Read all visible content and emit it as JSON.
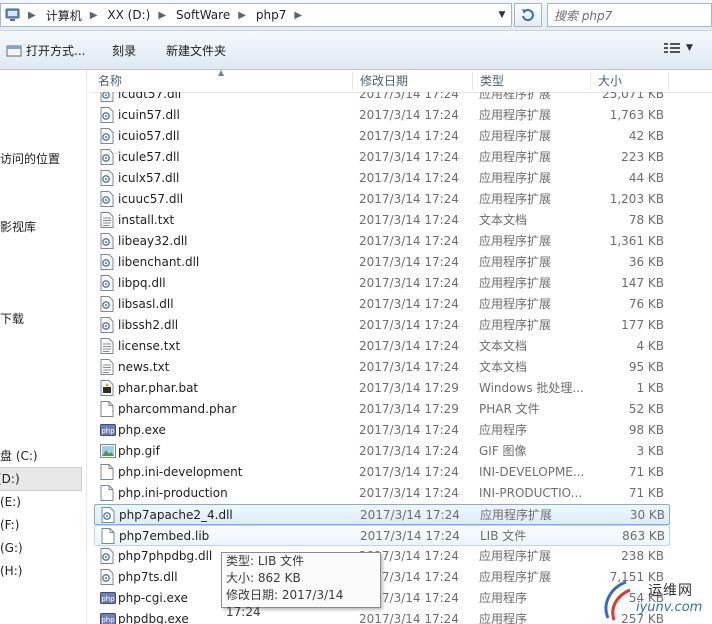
{
  "address": {
    "crumbs": [
      "计算机",
      "XX (D:)",
      "SoftWare",
      "php7"
    ]
  },
  "search": {
    "placeholder": "搜索 php7"
  },
  "toolbar": {
    "open_with": "打开方式...",
    "burn": "刻录",
    "new_folder": "新建文件夹"
  },
  "nav": {
    "items": [
      "访问的位置",
      "影视库",
      "下载",
      "盘 (C:)",
      "(D:)",
      "(E:)",
      "(F:)",
      "(G:)",
      "(H:)"
    ]
  },
  "columns": {
    "name": "名称",
    "date": "修改日期",
    "type": "类型",
    "size": "大小"
  },
  "files": [
    {
      "name": "icudt57.dll",
      "date": "2017/3/14 17:24",
      "type": "应用程序扩展",
      "size": "25,071 KB",
      "icon": "dll-icon"
    },
    {
      "name": "icuin57.dll",
      "date": "2017/3/14 17:24",
      "type": "应用程序扩展",
      "size": "1,763 KB",
      "icon": "dll-icon"
    },
    {
      "name": "icuio57.dll",
      "date": "2017/3/14 17:24",
      "type": "应用程序扩展",
      "size": "42 KB",
      "icon": "dll-icon"
    },
    {
      "name": "icule57.dll",
      "date": "2017/3/14 17:24",
      "type": "应用程序扩展",
      "size": "223 KB",
      "icon": "dll-icon"
    },
    {
      "name": "iculx57.dll",
      "date": "2017/3/14 17:24",
      "type": "应用程序扩展",
      "size": "44 KB",
      "icon": "dll-icon"
    },
    {
      "name": "icuuc57.dll",
      "date": "2017/3/14 17:24",
      "type": "应用程序扩展",
      "size": "1,203 KB",
      "icon": "dll-icon"
    },
    {
      "name": "install.txt",
      "date": "2017/3/14 17:24",
      "type": "文本文档",
      "size": "78 KB",
      "icon": "text-file-icon"
    },
    {
      "name": "libeay32.dll",
      "date": "2017/3/14 17:24",
      "type": "应用程序扩展",
      "size": "1,361 KB",
      "icon": "dll-icon"
    },
    {
      "name": "libenchant.dll",
      "date": "2017/3/14 17:24",
      "type": "应用程序扩展",
      "size": "36 KB",
      "icon": "dll-icon"
    },
    {
      "name": "libpq.dll",
      "date": "2017/3/14 17:24",
      "type": "应用程序扩展",
      "size": "147 KB",
      "icon": "dll-icon"
    },
    {
      "name": "libsasl.dll",
      "date": "2017/3/14 17:24",
      "type": "应用程序扩展",
      "size": "76 KB",
      "icon": "dll-icon"
    },
    {
      "name": "libssh2.dll",
      "date": "2017/3/14 17:24",
      "type": "应用程序扩展",
      "size": "177 KB",
      "icon": "dll-icon"
    },
    {
      "name": "license.txt",
      "date": "2017/3/14 17:24",
      "type": "文本文档",
      "size": "4 KB",
      "icon": "text-file-icon"
    },
    {
      "name": "news.txt",
      "date": "2017/3/14 17:24",
      "type": "文本文档",
      "size": "95 KB",
      "icon": "text-file-icon"
    },
    {
      "name": "phar.phar.bat",
      "date": "2017/3/14 17:29",
      "type": "Windows 批处理...",
      "size": "1 KB",
      "icon": "batch-file-icon"
    },
    {
      "name": "pharcommand.phar",
      "date": "2017/3/14 17:29",
      "type": "PHAR 文件",
      "size": "52 KB",
      "icon": "blank-file-icon"
    },
    {
      "name": "php.exe",
      "date": "2017/3/14 17:24",
      "type": "应用程序",
      "size": "98 KB",
      "icon": "php-exe-icon"
    },
    {
      "name": "php.gif",
      "date": "2017/3/14 17:24",
      "type": "GIF 图像",
      "size": "3 KB",
      "icon": "image-file-icon"
    },
    {
      "name": "php.ini-development",
      "date": "2017/3/14 17:24",
      "type": "INI-DEVELOPME...",
      "size": "71 KB",
      "icon": "blank-file-icon"
    },
    {
      "name": "php.ini-production",
      "date": "2017/3/14 17:24",
      "type": "INI-PRODUCTIO...",
      "size": "71 KB",
      "icon": "blank-file-icon"
    },
    {
      "name": "php7apache2_4.dll",
      "date": "2017/3/14 17:24",
      "type": "应用程序扩展",
      "size": "30 KB",
      "icon": "dll-icon"
    },
    {
      "name": "php7embed.lib",
      "date": "2017/3/14 17:24",
      "type": "LIB 文件",
      "size": "863 KB",
      "icon": "blank-file-icon"
    },
    {
      "name": "php7phpdbg.dll",
      "date": "2017/3/14 17:24",
      "type": "应用程序扩展",
      "size": "238 KB",
      "icon": "dll-icon"
    },
    {
      "name": "php7ts.dll",
      "date": "2017/3/14 17:24",
      "type": "应用程序扩展",
      "size": "7,151 KB",
      "icon": "dll-icon"
    },
    {
      "name": "php-cgi.exe",
      "date": "2017/3/14 17:24",
      "type": "应用程序",
      "size": "54 KB",
      "icon": "php-exe-icon"
    },
    {
      "name": "phpdbg.exe",
      "date": "2017/3/14 17:24",
      "type": "应用程序",
      "size": "257 KB",
      "icon": "php-exe-icon"
    }
  ],
  "selected_file": "php7apache2_4.dll",
  "hovered_file": "php7embed.lib",
  "tooltip": {
    "type_line": "类型: LIB 文件",
    "size_line": "大小: 862 KB",
    "date_line": "修改日期: 2017/3/14 17:24"
  },
  "watermark": {
    "line1": "运维网",
    "line2": "iyunv.com"
  },
  "colors": {
    "selection_border": "#84acdd",
    "hover_border": "#b8d6fb",
    "header_text": "#4c607a"
  }
}
